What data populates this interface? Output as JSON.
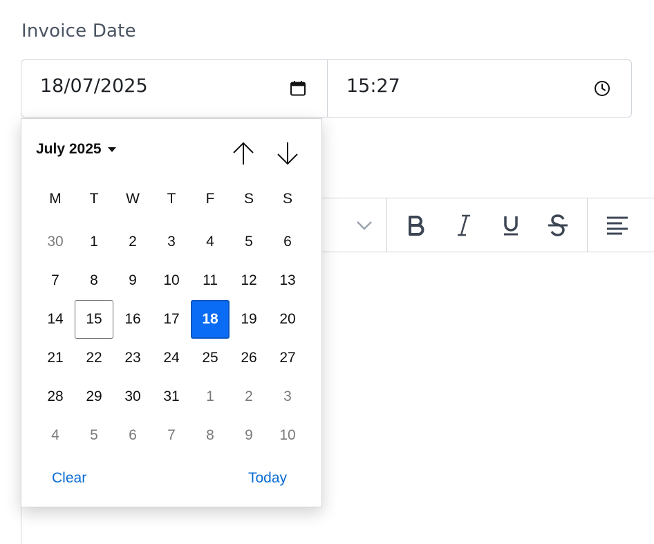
{
  "form": {
    "label": "Invoice Date",
    "date_value": "18/07/2025",
    "time_value": "15:27"
  },
  "icons": {
    "date": "calendar-icon",
    "time": "clock-icon",
    "month_dropdown": "caret-down-icon",
    "prev": "arrow-up-icon",
    "next": "arrow-down-icon"
  },
  "toolbar": {
    "buttons": [
      "chevron-down-icon",
      "bold-icon",
      "italic-icon",
      "underline-icon",
      "strikethrough-icon",
      "align-left-icon"
    ]
  },
  "calendar": {
    "month_label": "July 2025",
    "weekdays": [
      "M",
      "T",
      "W",
      "T",
      "F",
      "S",
      "S"
    ],
    "weeks": [
      [
        {
          "d": "30",
          "other": true
        },
        {
          "d": "1"
        },
        {
          "d": "2"
        },
        {
          "d": "3"
        },
        {
          "d": "4"
        },
        {
          "d": "5"
        },
        {
          "d": "6"
        }
      ],
      [
        {
          "d": "7"
        },
        {
          "d": "8"
        },
        {
          "d": "9"
        },
        {
          "d": "10"
        },
        {
          "d": "11"
        },
        {
          "d": "12"
        },
        {
          "d": "13"
        }
      ],
      [
        {
          "d": "14"
        },
        {
          "d": "15",
          "outlined": true
        },
        {
          "d": "16"
        },
        {
          "d": "17"
        },
        {
          "d": "18",
          "selected": true
        },
        {
          "d": "19"
        },
        {
          "d": "20"
        }
      ],
      [
        {
          "d": "21"
        },
        {
          "d": "22"
        },
        {
          "d": "23"
        },
        {
          "d": "24"
        },
        {
          "d": "25"
        },
        {
          "d": "26"
        },
        {
          "d": "27"
        }
      ],
      [
        {
          "d": "28"
        },
        {
          "d": "29"
        },
        {
          "d": "30"
        },
        {
          "d": "31"
        },
        {
          "d": "1",
          "other": true
        },
        {
          "d": "2",
          "other": true
        },
        {
          "d": "3",
          "other": true
        }
      ],
      [
        {
          "d": "4",
          "other": true
        },
        {
          "d": "5",
          "other": true
        },
        {
          "d": "6",
          "other": true
        },
        {
          "d": "7",
          "other": true
        },
        {
          "d": "8",
          "other": true
        },
        {
          "d": "9",
          "other": true
        },
        {
          "d": "10",
          "other": true
        }
      ]
    ],
    "clear_label": "Clear",
    "today_label": "Today"
  },
  "colors": {
    "selected_bg": "#0a6cf5",
    "link": "#0a6cd4",
    "label": "#4a5461",
    "border": "#cfd4da"
  }
}
